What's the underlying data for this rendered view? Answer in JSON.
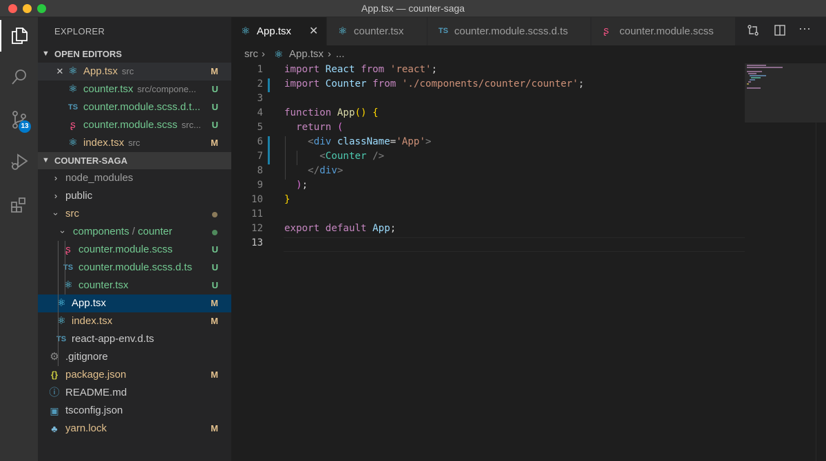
{
  "window": {
    "title": "App.tsx — counter-saga"
  },
  "activity": {
    "scm_badge": "13"
  },
  "explorer": {
    "title": "EXPLORER",
    "open_editors_title": "OPEN EDITORS",
    "open_editors": [
      {
        "name": "App.tsx",
        "path": "src",
        "status": "M",
        "icon": "react-icon",
        "close": "✕"
      },
      {
        "name": "counter.tsx",
        "path": "src/compone...",
        "status": "U",
        "icon": "react-icon"
      },
      {
        "name": "counter.module.scss.d.t...",
        "path": "",
        "status": "U",
        "icon": "ts-icon"
      },
      {
        "name": "counter.module.scss",
        "path": "src...",
        "status": "U",
        "icon": "sass-icon"
      },
      {
        "name": "index.tsx",
        "path": "src",
        "status": "M",
        "icon": "react-icon"
      }
    ],
    "project_title": "COUNTER-SAGA",
    "tree": {
      "node_modules": "node_modules",
      "public": "public",
      "src": "src",
      "components_folder": "components",
      "components_sep": " / ",
      "counter_folder": "counter",
      "files_counter": [
        {
          "name": "counter.module.scss",
          "status": "U"
        },
        {
          "name": "counter.module.scss.d.ts",
          "status": "U"
        },
        {
          "name": "counter.tsx",
          "status": "U"
        }
      ],
      "files_src": [
        {
          "name": "App.tsx",
          "status": "M"
        },
        {
          "name": "index.tsx",
          "status": "M"
        },
        {
          "name": "react-app-env.d.ts",
          "status": ""
        }
      ],
      "files_root": [
        {
          "name": ".gitignore",
          "status": ""
        },
        {
          "name": "package.json",
          "status": "M"
        },
        {
          "name": "README.md",
          "status": ""
        },
        {
          "name": "tsconfig.json",
          "status": ""
        },
        {
          "name": "yarn.lock",
          "status": "M"
        }
      ]
    }
  },
  "tabs": [
    {
      "label": "App.tsx",
      "icon": "react-icon",
      "close": "✕"
    },
    {
      "label": "counter.tsx",
      "icon": "react-icon"
    },
    {
      "label": "counter.module.scss.d.ts",
      "icon": "ts-icon"
    },
    {
      "label": "counter.module.scss",
      "icon": "sass-icon"
    }
  ],
  "breadcrumb": {
    "folder": "src",
    "file": "App.tsx",
    "more": "..."
  },
  "editor": {
    "line_numbers": [
      "1",
      "2",
      "3",
      "4",
      "5",
      "6",
      "7",
      "8",
      "9",
      "10",
      "11",
      "12",
      "13"
    ],
    "tokens": {
      "import": "import",
      "react_id": "React",
      "from": "from",
      "react_str": "'react'",
      "semi": ";",
      "counter_id": "Counter",
      "counter_str": "'./components/counter/counter'",
      "function": "function",
      "app_fn": "App",
      "parens": "()",
      "lbrace": "{",
      "return": "return",
      "lparen": "(",
      "lt": "<",
      "div": "div",
      "classname": "className",
      "eq": "=",
      "app_str": "'App'",
      "gt": ">",
      "counter_comp": "Counter",
      "selfclose": " />",
      "close_div_open": "</",
      "rparen": ")",
      "rbrace": "}",
      "export": "export",
      "default": "default",
      "app_id": "App"
    }
  },
  "colors": {
    "accent": "#007acc",
    "modified": "#e2c08d",
    "untracked": "#73c991",
    "selection": "#04395e"
  }
}
